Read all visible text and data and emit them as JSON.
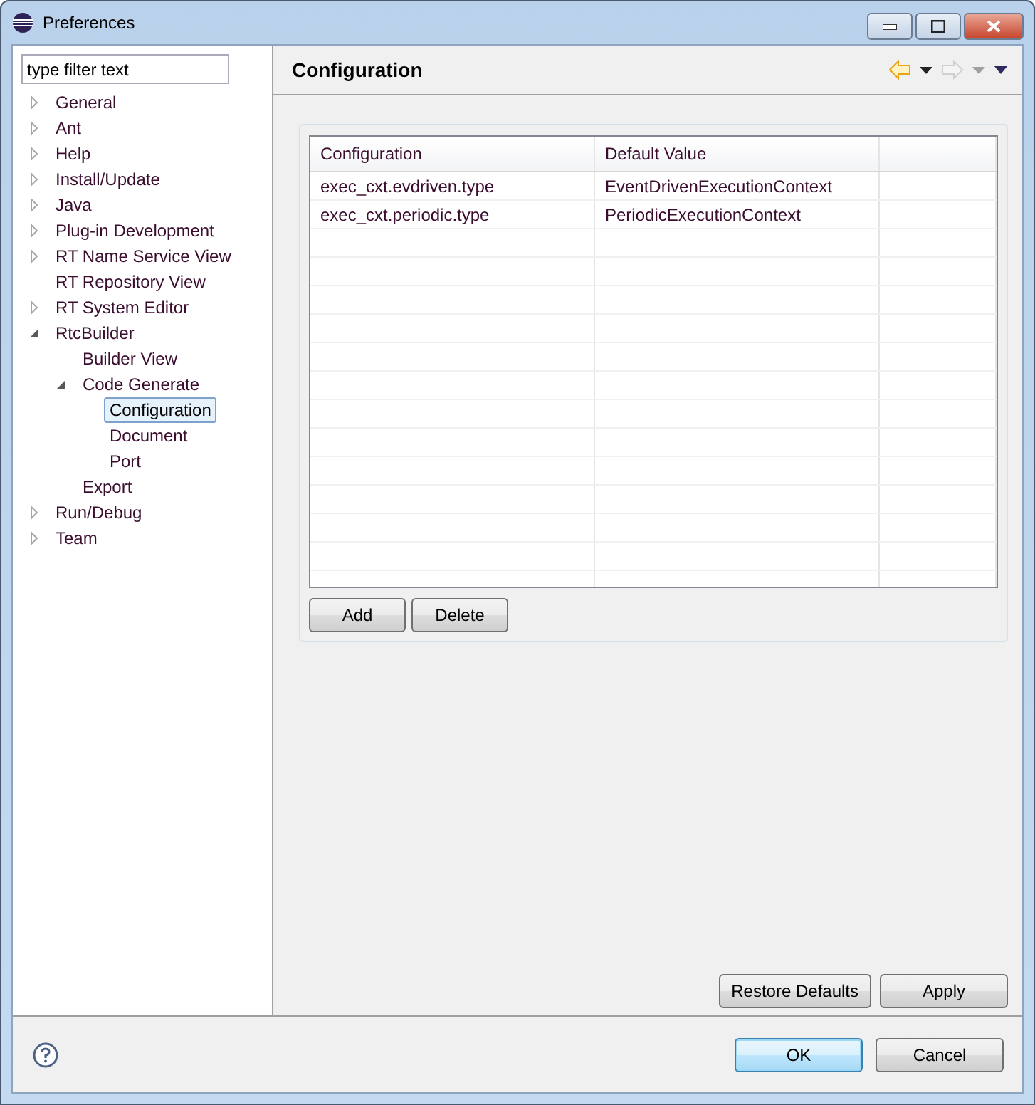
{
  "window": {
    "title": "Preferences"
  },
  "filter": {
    "placeholder": "type filter text"
  },
  "tree": [
    {
      "label": "General",
      "kind": "folder",
      "expanded": false,
      "selected": false
    },
    {
      "label": "Ant",
      "kind": "folder",
      "expanded": false,
      "selected": false
    },
    {
      "label": "Help",
      "kind": "folder",
      "expanded": false,
      "selected": false
    },
    {
      "label": "Install/Update",
      "kind": "folder",
      "expanded": false,
      "selected": false
    },
    {
      "label": "Java",
      "kind": "folder",
      "expanded": false,
      "selected": false
    },
    {
      "label": "Plug-in Development",
      "kind": "folder",
      "expanded": false,
      "selected": false
    },
    {
      "label": "RT Name Service View",
      "kind": "folder",
      "expanded": false,
      "selected": false
    },
    {
      "label": "RT Repository View",
      "kind": "leaf",
      "selected": false
    },
    {
      "label": "RT System Editor",
      "kind": "folder",
      "expanded": false,
      "selected": false
    },
    {
      "label": "RtcBuilder",
      "kind": "folder",
      "expanded": true,
      "selected": false,
      "children": [
        {
          "label": "Builder View",
          "kind": "leaf",
          "selected": false
        },
        {
          "label": "Code Generate",
          "kind": "folder",
          "expanded": true,
          "selected": false,
          "children": [
            {
              "label": "Configuration",
              "kind": "leaf",
              "selected": true
            },
            {
              "label": "Document",
              "kind": "leaf",
              "selected": false
            },
            {
              "label": "Port",
              "kind": "leaf",
              "selected": false
            }
          ]
        },
        {
          "label": "Export",
          "kind": "leaf",
          "selected": false
        }
      ]
    },
    {
      "label": "Run/Debug",
      "kind": "folder",
      "expanded": false,
      "selected": false
    },
    {
      "label": "Team",
      "kind": "folder",
      "expanded": false,
      "selected": false
    }
  ],
  "page": {
    "title": "Configuration",
    "nav": [
      {
        "kind": "back",
        "disabled": false
      },
      {
        "kind": "forward",
        "disabled": true
      }
    ]
  },
  "table": {
    "columns": [
      "Configuration",
      "Default Value"
    ],
    "rows": [
      [
        "exec_cxt.evdriven.type",
        "EventDrivenExecutionContext"
      ],
      [
        "exec_cxt.periodic.type",
        "PeriodicExecutionContext"
      ]
    ]
  },
  "table_buttons": [
    "Add",
    "Delete"
  ],
  "page_buttons": [
    "Restore Defaults",
    "Apply"
  ],
  "dialog_buttons": [
    {
      "label": "OK",
      "default": true
    },
    {
      "label": "Cancel",
      "default": false
    }
  ]
}
